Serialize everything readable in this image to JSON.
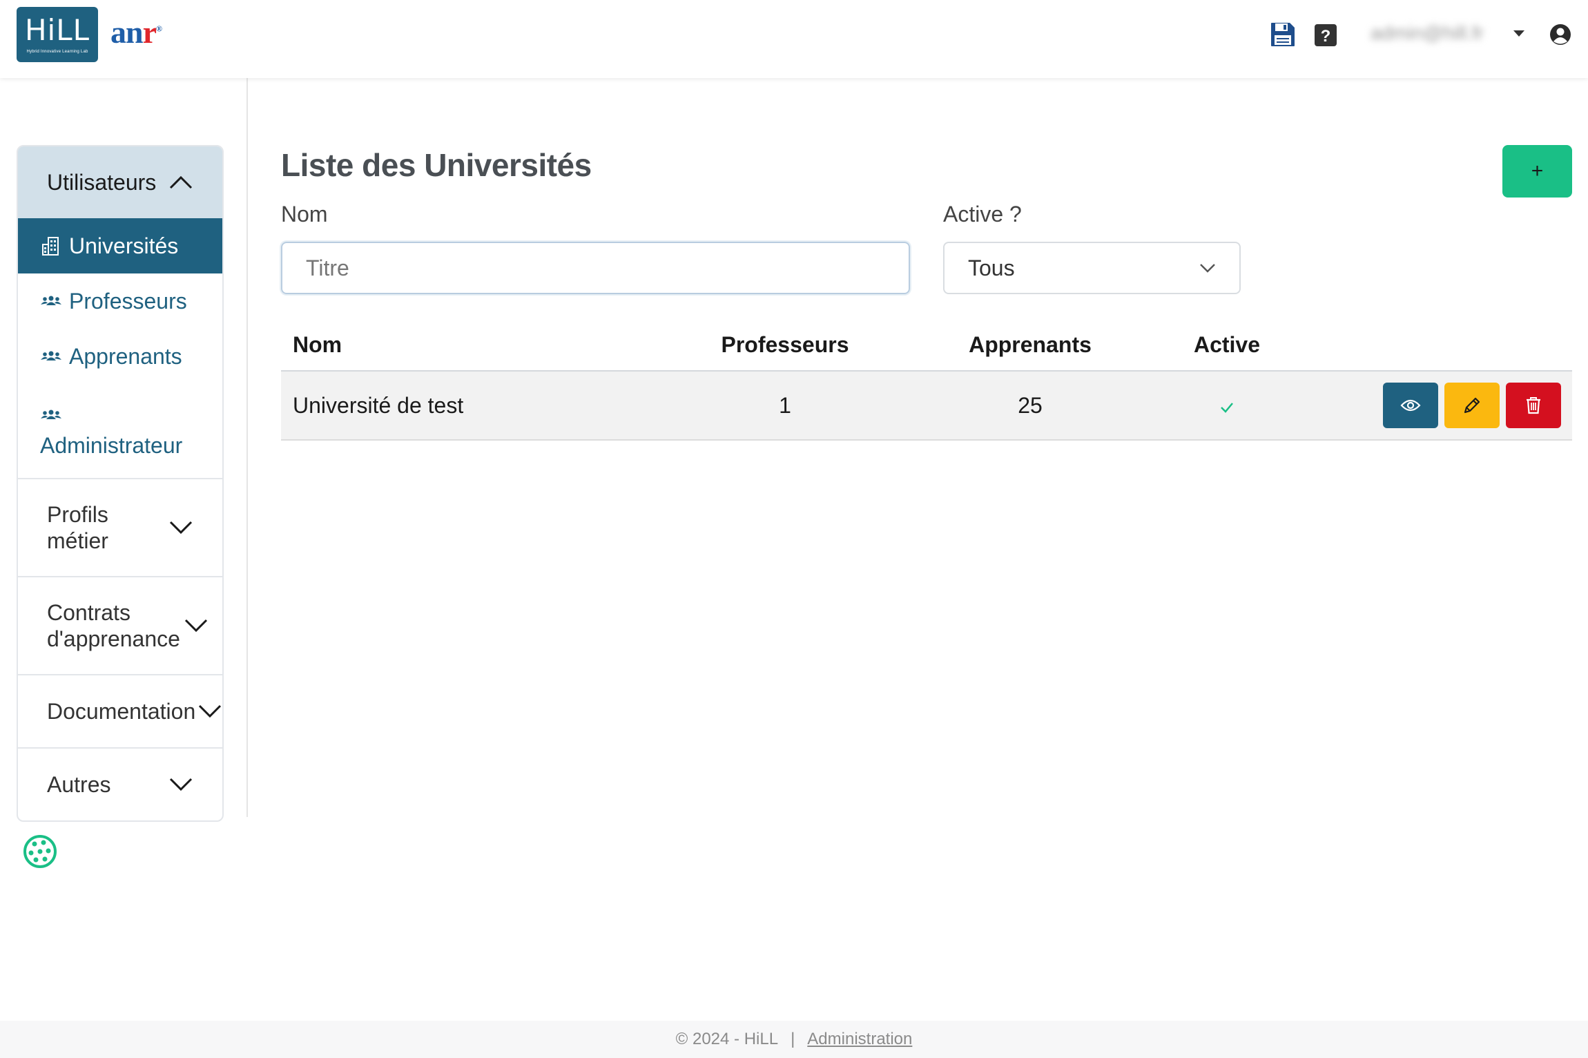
{
  "header": {
    "logo_hill_text": "HiLL",
    "logo_hill_subtitle": "Hybrid Innovative Learning Lab",
    "logo_anr_text": "an",
    "logo_anr_r": "r",
    "logo_anr_mark": "®",
    "user_email": "admin@hill.fr",
    "icons": [
      "save-icon",
      "help-icon",
      "caret-down-icon",
      "user-circle-icon"
    ]
  },
  "sidebar": {
    "sections": [
      {
        "label": "Utilisateurs",
        "expanded": true,
        "items": [
          {
            "label": "Universités",
            "icon": "building-icon",
            "active": true
          },
          {
            "label": "Professeurs",
            "icon": "users-icon",
            "active": false
          },
          {
            "label": "Apprenants",
            "icon": "users-icon",
            "active": false
          },
          {
            "label": "Administrateur",
            "icon": "users-icon",
            "active": false
          }
        ]
      },
      {
        "label": "Profils\nmétier",
        "expanded": false
      },
      {
        "label": "Contrats\nd'apprenance",
        "expanded": false
      },
      {
        "label": "Documentation",
        "expanded": false
      },
      {
        "label": "Autres",
        "expanded": false
      }
    ]
  },
  "main": {
    "title": "Liste des Universités",
    "add_button_label": "+",
    "filters": {
      "name_label": "Nom",
      "name_placeholder": "Titre",
      "active_label": "Active ?",
      "active_value": "Tous"
    },
    "table": {
      "columns": [
        "Nom",
        "Professeurs",
        "Apprenants",
        "Active"
      ],
      "rows": [
        {
          "nom": "Université de test",
          "professeurs": "1",
          "apprenants": "25",
          "active": "✓"
        }
      ]
    }
  },
  "footer": {
    "copyright": "© 2024 - HiLL",
    "separator": "|",
    "link": "Administration"
  },
  "colors": {
    "brand": "#1f6180",
    "add": "#1abf86",
    "edit": "#fbb80f",
    "delete": "#d4101f",
    "check": "#1abf86"
  }
}
